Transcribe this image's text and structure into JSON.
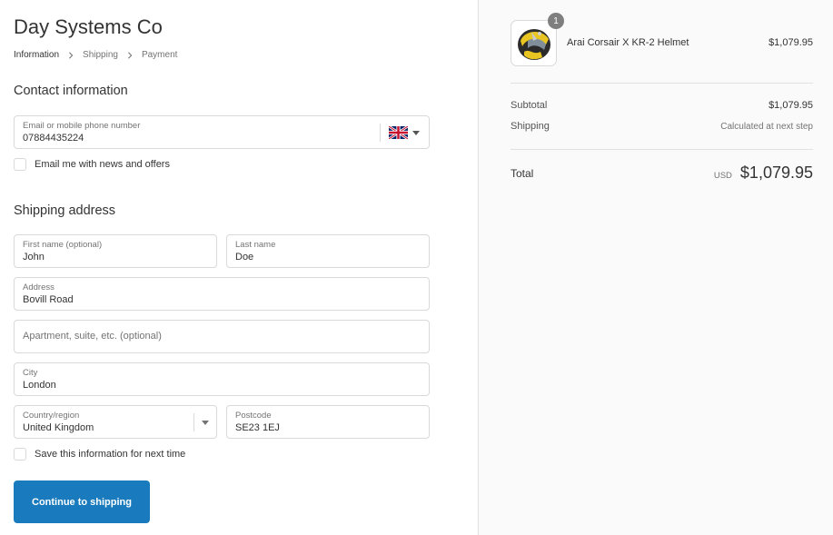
{
  "shop": {
    "title": "Day Systems Co"
  },
  "breadcrumb": {
    "items": [
      "Information",
      "Shipping",
      "Payment"
    ]
  },
  "contact": {
    "title": "Contact information",
    "email_label": "Email or mobile phone number",
    "email_value": "07884435224",
    "newsletter_label": "Email me with news and offers"
  },
  "shipping": {
    "title": "Shipping address",
    "first_name_label": "First name (optional)",
    "first_name_value": "John",
    "last_name_label": "Last name",
    "last_name_value": "Doe",
    "address_label": "Address",
    "address_value": "Bovill Road",
    "apartment_placeholder": "Apartment, suite, etc. (optional)",
    "city_label": "City",
    "city_value": "London",
    "country_label": "Country/region",
    "country_value": "United Kingdom",
    "postcode_label": "Postcode",
    "postcode_value": "SE23 1EJ",
    "save_info_label": "Save this information for next time"
  },
  "actions": {
    "continue_label": "Continue to shipping"
  },
  "order": {
    "product": {
      "name": "Arai Corsair X KR-2 Helmet",
      "price": "$1,079.95",
      "quantity": "1"
    },
    "subtotal_label": "Subtotal",
    "subtotal_value": "$1,079.95",
    "shipping_label": "Shipping",
    "shipping_value": "Calculated at next step",
    "total_label": "Total",
    "currency": "USD",
    "total_value": "$1,079.95"
  },
  "colors": {
    "primary_button": "#197bbd",
    "sidebar_bg": "#fafafa",
    "border": "#d9d9d9"
  },
  "icons": [
    "chevron-right-icon",
    "uk-flag-icon",
    "caret-down-icon",
    "helmet-product-image"
  ]
}
